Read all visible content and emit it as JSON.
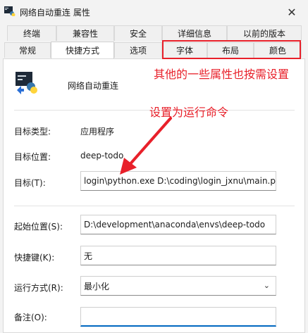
{
  "window": {
    "title": "网络自动重连 属性",
    "close_glyph": "✕"
  },
  "tabs_row1": [
    "终端",
    "兼容性",
    "安全",
    "详细信息",
    "以前的版本"
  ],
  "tabs_row2": [
    "常规",
    "快捷方式",
    "选项",
    "字体",
    "布局",
    "颜色"
  ],
  "active_tab": "快捷方式",
  "annotations": {
    "other_props": "其他的一些属性也按需设置",
    "set_target": "设置为运行命令"
  },
  "shortcut": {
    "name": "网络自动重连",
    "target_type_label": "目标类型:",
    "target_type_value": "应用程序",
    "target_location_label": "目标位置:",
    "target_location_value": "deep-todo",
    "target_label": "目标(T):",
    "target_value": "login\\python.exe D:\\coding\\login_jxnu\\main.py",
    "start_in_label": "起始位置(S):",
    "start_in_value": "D:\\development\\anaconda\\envs\\deep-todo",
    "hotkey_label": "快捷键(K):",
    "hotkey_value": "无",
    "run_label": "运行方式(R):",
    "run_value": "最小化",
    "comment_label": "备注(O):",
    "comment_value": ""
  },
  "colors": {
    "accent": "#0067c0",
    "annotation": "#e8202a"
  },
  "icons": [
    "python-app-icon",
    "close-icon",
    "chevron-down-icon",
    "arrow-icon"
  ]
}
